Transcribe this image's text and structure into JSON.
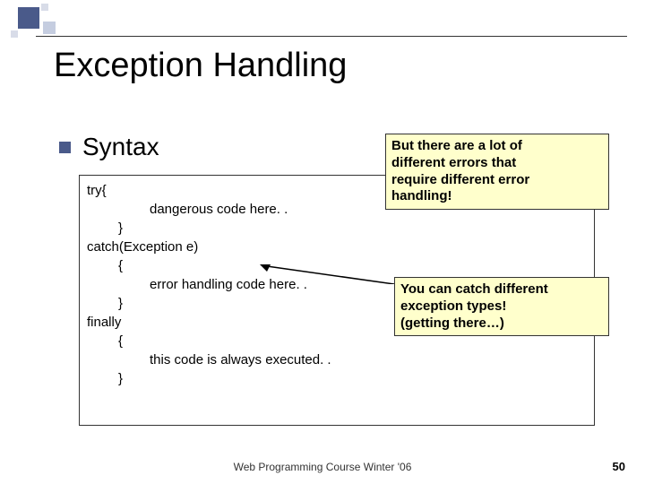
{
  "title": "Exception Handling",
  "section_label": "Syntax",
  "code": {
    "try_open": "try{",
    "danger": "dangerous code here. .",
    "try_close": "}",
    "catch_open": "catch(Exception e)",
    "brace_open1": "{",
    "error_handle": "error handling code here. .",
    "brace_close1": "}",
    "finally_kw": "finally",
    "brace_open2": "{",
    "always": "this code is always executed. .",
    "brace_close2": "}"
  },
  "note1": {
    "line1": "But there are a lot of",
    "line2": "different errors that",
    "line3": "require different error",
    "line4": "handling!"
  },
  "note2": {
    "line1": "You can catch different",
    "line2": "exception types!",
    "line3": "(getting there…)"
  },
  "footer": "Web Programming Course Winter '06",
  "page_number": "50"
}
